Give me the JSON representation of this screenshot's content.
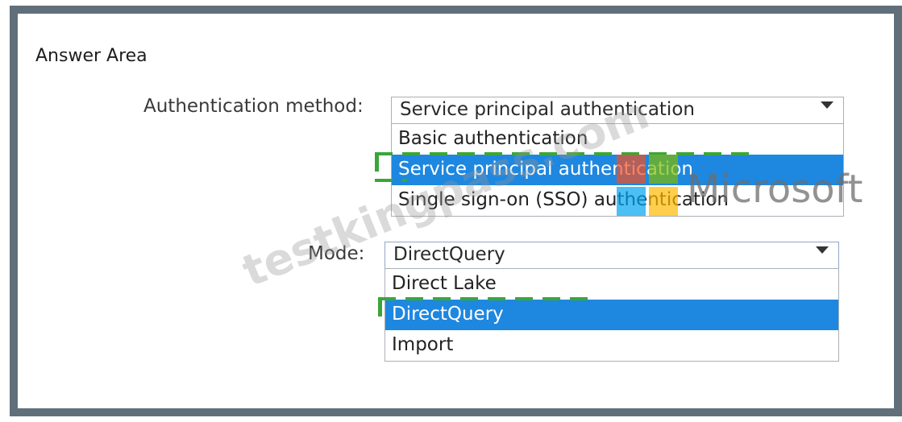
{
  "answer_area": {
    "title": "Answer Area"
  },
  "authentication": {
    "label": "Authentication method:",
    "selected": "Service principal authentication",
    "options": [
      "Basic authentication",
      "Service principal authentication",
      "Single sign-on (SSO) authentication"
    ],
    "highlighted_index": 1
  },
  "mode": {
    "label": "Mode:",
    "selected": "DirectQuery",
    "options": [
      "Direct Lake",
      "DirectQuery",
      "Import"
    ],
    "highlighted_index": 1
  },
  "watermark": {
    "text": "testkingpass.com",
    "brand": "Microsoft"
  },
  "colors": {
    "highlight": "#1e87e0",
    "frame": "#616f7b",
    "answer_marker": "#3aa63a"
  },
  "icons": {
    "dropdown_arrow": "chevron-down-icon",
    "brand_logo": "microsoft-logo-icon"
  }
}
